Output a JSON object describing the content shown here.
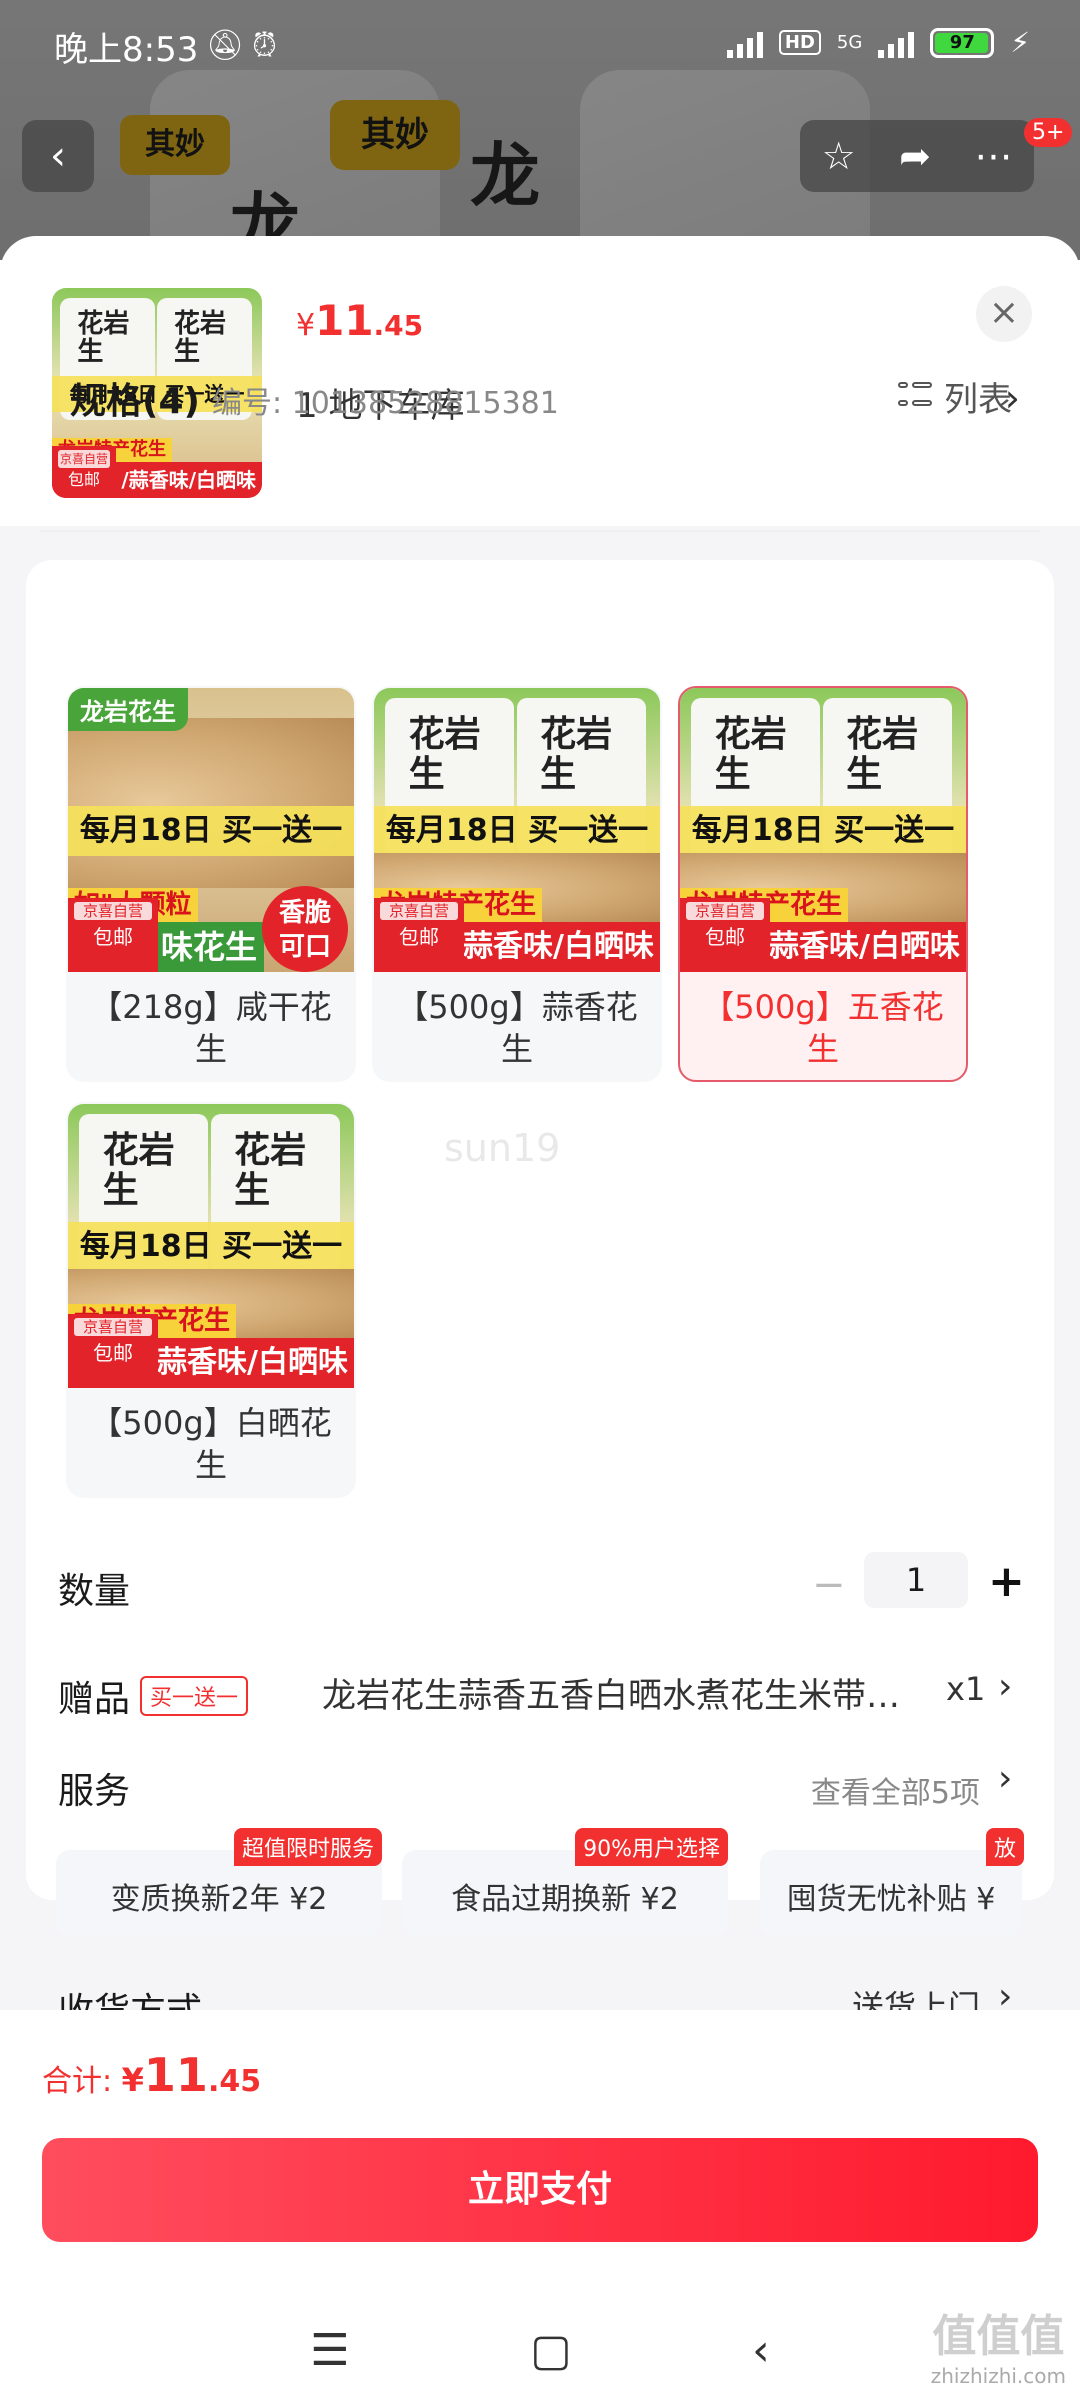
{
  "status_bar": {
    "time": "晚上8:53",
    "network": "5G",
    "hd": "HD",
    "battery": "97",
    "battery_pct": 0.97
  },
  "nav": {
    "badge": "5+"
  },
  "sheet": {
    "price": {
      "currency": "¥",
      "integer": "11",
      "decimal": ".45"
    },
    "address": "1  地下车库",
    "spec": {
      "title": "规格(4)",
      "code": "编号: 10138528815381",
      "list_toggle": "列表"
    },
    "skus": [
      {
        "name": "【218g】咸干花生",
        "selected": false
      },
      {
        "name": "【500g】蒜香花生",
        "selected": false
      },
      {
        "name": "【500g】五香花生",
        "selected": true
      },
      {
        "name": "【500g】白晒花生",
        "selected": false
      }
    ],
    "art": {
      "banner": "每月18日 买一送一",
      "flavors": "/蒜香味/白晒味",
      "local": "龙岩特产花生",
      "jd": "京喜自营",
      "free_ship": "包邮",
      "bag_text": "花岩生",
      "salty_corner": "龙岩花生",
      "salty_green": "味花生",
      "salty_crisp_1": "香脆",
      "salty_crisp_2": "可口",
      "salty_yellow": "如\"大颗粒"
    },
    "watermark": "sun19",
    "quantity": {
      "label": "数量",
      "minus": "−",
      "value": "1",
      "plus": "+"
    },
    "gift": {
      "label": "赠品",
      "tag": "买一送一",
      "text": "龙岩花生蒜香五香白晒水煮花生米带…",
      "qty": "x1"
    },
    "service": {
      "label": "服务",
      "all": "查看全部5项",
      "items": [
        {
          "label": "变质换新2年  ¥2",
          "flag": "超值限时服务"
        },
        {
          "label": "食品过期换新  ¥2",
          "flag": "90%用户选择"
        },
        {
          "label": "囤货无忧补贴  ¥",
          "flag": "放"
        }
      ]
    },
    "delivery": {
      "label": "收货方式",
      "value": "送货上门"
    }
  },
  "bottom": {
    "total_label": "合计: ",
    "total": {
      "currency": "¥",
      "integer": "11",
      "decimal": ".45"
    },
    "pay": "立即支付"
  },
  "site_watermark": {
    "logo": "值值值",
    "url": "zhizhizhi.com"
  },
  "colors": {
    "accent": "#f23030",
    "pay_gradient_start": "#ff4d5e",
    "pay_gradient_end": "#ff1a2e"
  }
}
